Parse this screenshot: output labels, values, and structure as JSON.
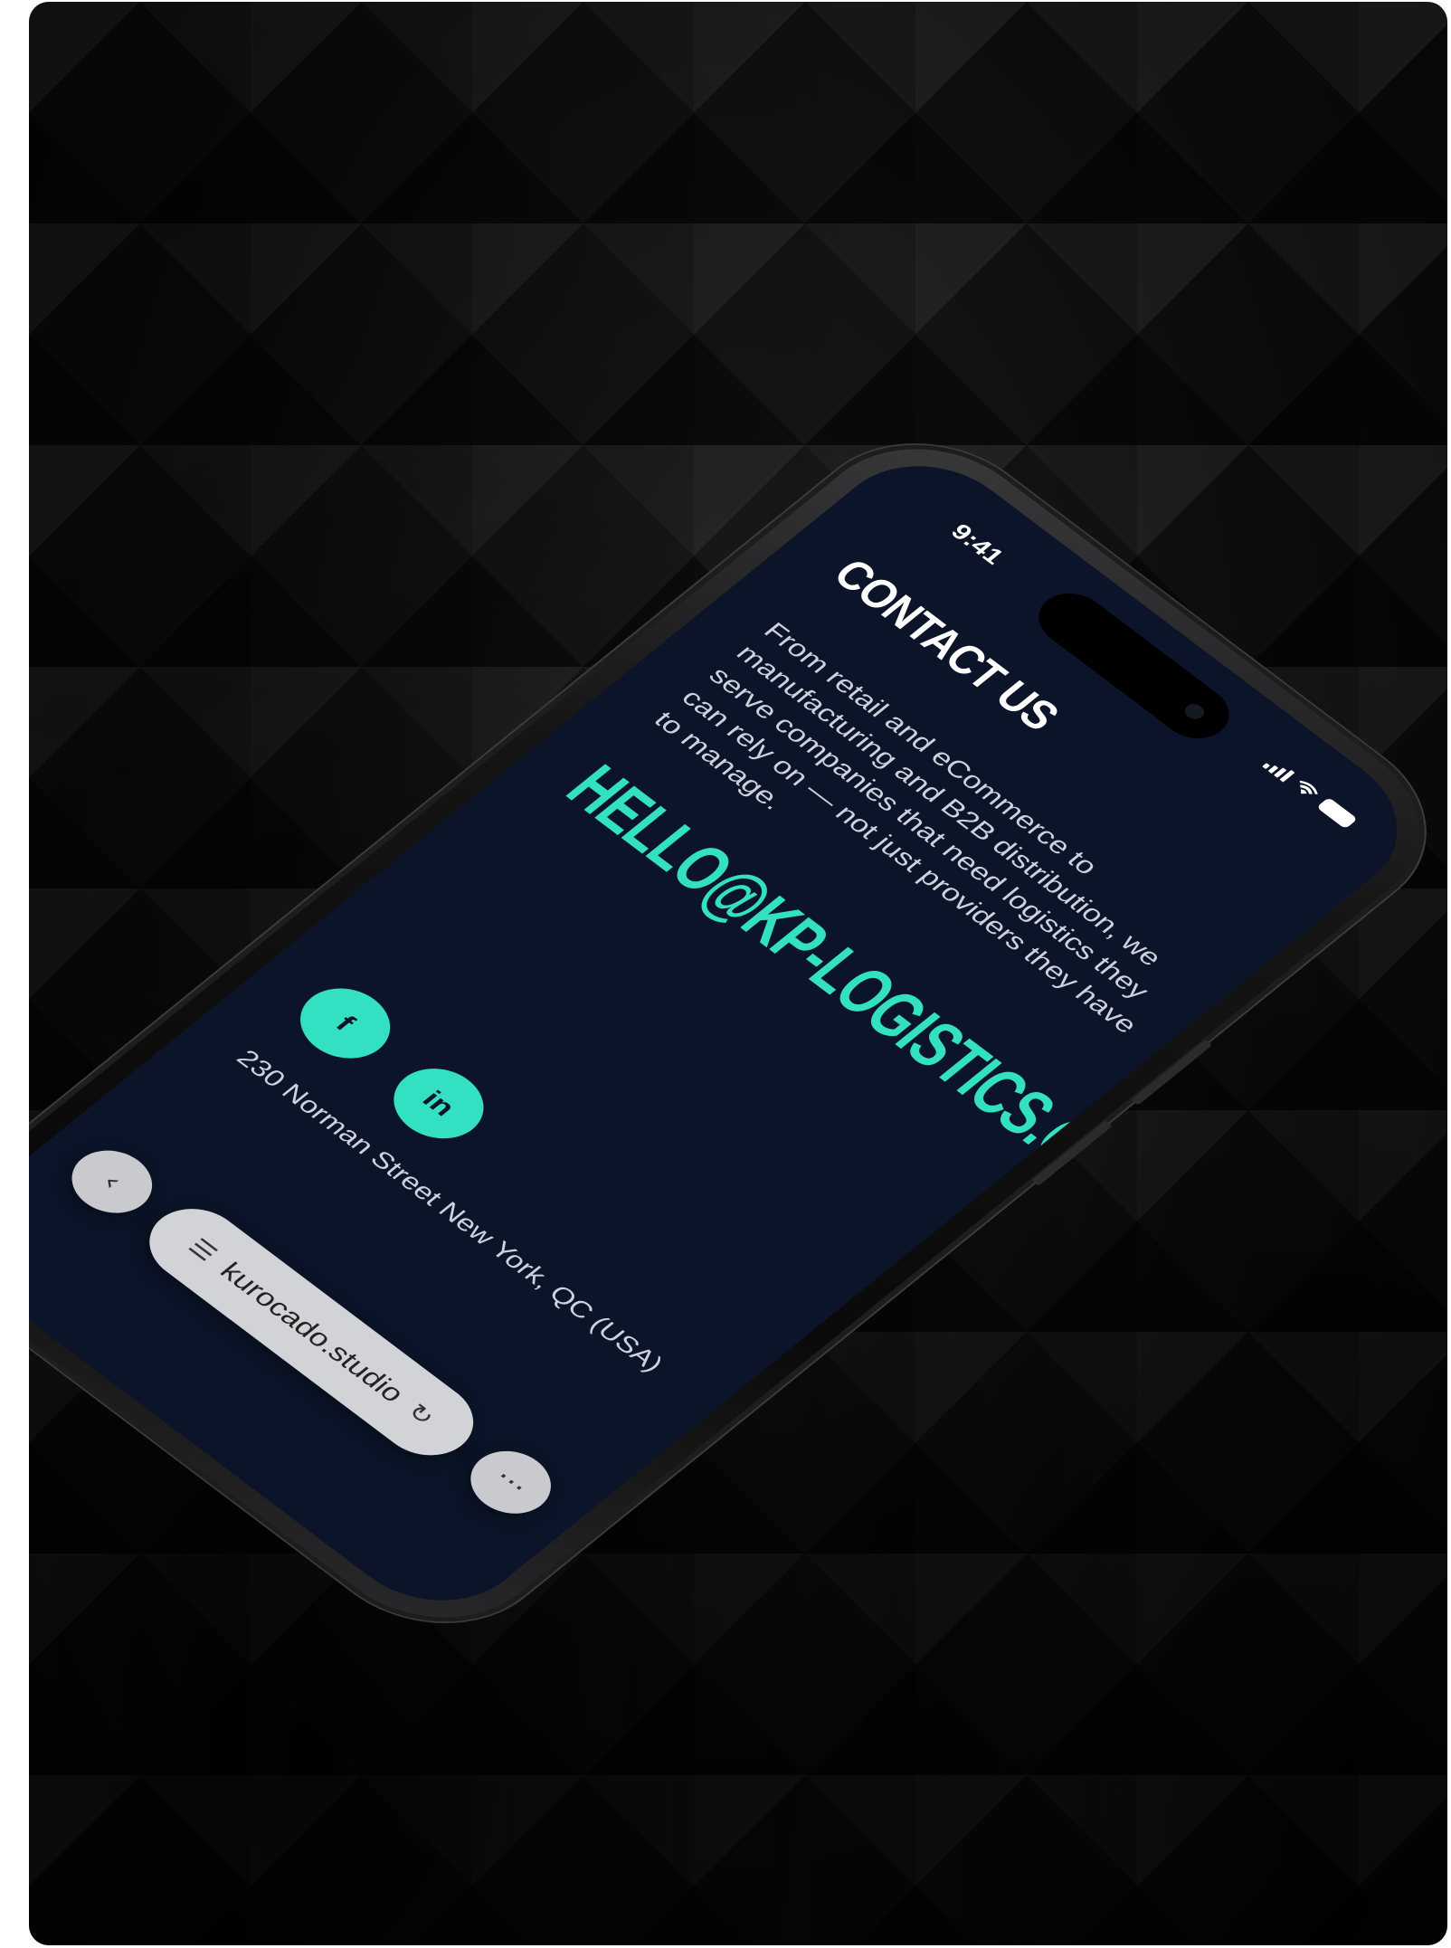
{
  "status_bar": {
    "time": "9:41"
  },
  "page": {
    "title": "CONTACT US",
    "intro": "From retail and eCommerce to manufacturing and B2B distribution, we serve companies that need logistics they can rely on — not just providers they have to manage.",
    "email": "HELLO@KP-LOGISTICS.COM",
    "address": "230 Norman Street New York, QC (USA)"
  },
  "social": {
    "facebook_label": "f",
    "linkedin_label": "in"
  },
  "browser": {
    "url": "kurocado.studio",
    "back_glyph": "‹",
    "reader_glyph": "☰",
    "reload_glyph": "↻",
    "more_glyph": "···"
  },
  "colors": {
    "accent": "#33e0c1",
    "screen_background": "#0b1428",
    "text_primary": "#ffffff",
    "text_secondary": "#cdd3dd"
  }
}
